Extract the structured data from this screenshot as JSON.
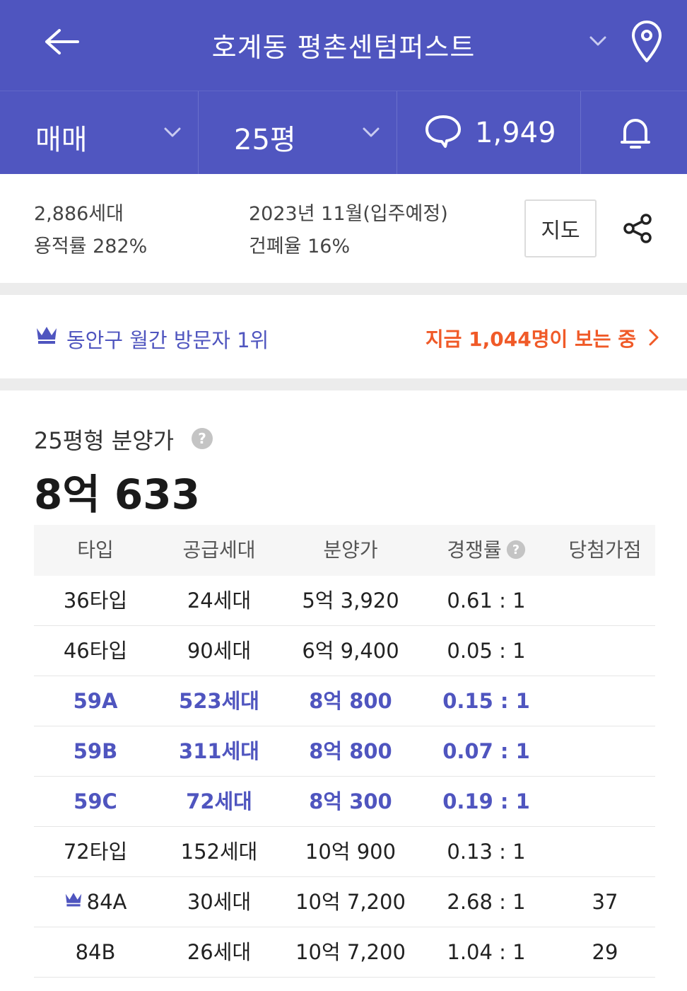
{
  "header": {
    "title": "호계동 평촌센텀퍼스트",
    "icons": {
      "back": "arrow-left-icon",
      "dropdown": "chevron-down-icon",
      "location": "map-pin-icon"
    }
  },
  "filters": {
    "trade_type": "매매",
    "area": "25평",
    "comment_count": "1,949"
  },
  "info": {
    "households": "2,886세대",
    "floor_area_ratio": "용적률 282%",
    "move_in": "2023년 11월(입주예정)",
    "coverage_ratio": "건폐율 16%",
    "map_button": "지도"
  },
  "banner": {
    "rank_text": "동안구 월간 방문자 1위",
    "live_viewers": "지금 1,044명이 보는 중"
  },
  "price": {
    "label": "25평형 분양가",
    "value": "8억 633"
  },
  "table": {
    "headers": [
      "타입",
      "공급세대",
      "분양가",
      "경쟁률",
      "당첨가점"
    ],
    "rows": [
      {
        "type": "36타입",
        "units": "24세대",
        "price": "5억 3,920",
        "ratio": "0.61 : 1",
        "score": "",
        "highlight": false,
        "crown": false
      },
      {
        "type": "46타입",
        "units": "90세대",
        "price": "6억 9,400",
        "ratio": "0.05 : 1",
        "score": "",
        "highlight": false,
        "crown": false
      },
      {
        "type": "59A",
        "units": "523세대",
        "price": "8억 800",
        "ratio": "0.15 : 1",
        "score": "",
        "highlight": true,
        "crown": false
      },
      {
        "type": "59B",
        "units": "311세대",
        "price": "8억 800",
        "ratio": "0.07 : 1",
        "score": "",
        "highlight": true,
        "crown": false
      },
      {
        "type": "59C",
        "units": "72세대",
        "price": "8억 300",
        "ratio": "0.19 : 1",
        "score": "",
        "highlight": true,
        "crown": false
      },
      {
        "type": "72타입",
        "units": "152세대",
        "price": "10억 900",
        "ratio": "0.13 : 1",
        "score": "",
        "highlight": false,
        "crown": false
      },
      {
        "type": "84A",
        "units": "30세대",
        "price": "10억 7,200",
        "ratio": "2.68 : 1",
        "score": "37",
        "highlight": false,
        "crown": true
      },
      {
        "type": "84B",
        "units": "26세대",
        "price": "10억 7,200",
        "ratio": "1.04 : 1",
        "score": "29",
        "highlight": false,
        "crown": false
      }
    ]
  },
  "colors": {
    "brand": "#4f55bf",
    "accent": "#f05a28",
    "separator": "#ececec"
  }
}
